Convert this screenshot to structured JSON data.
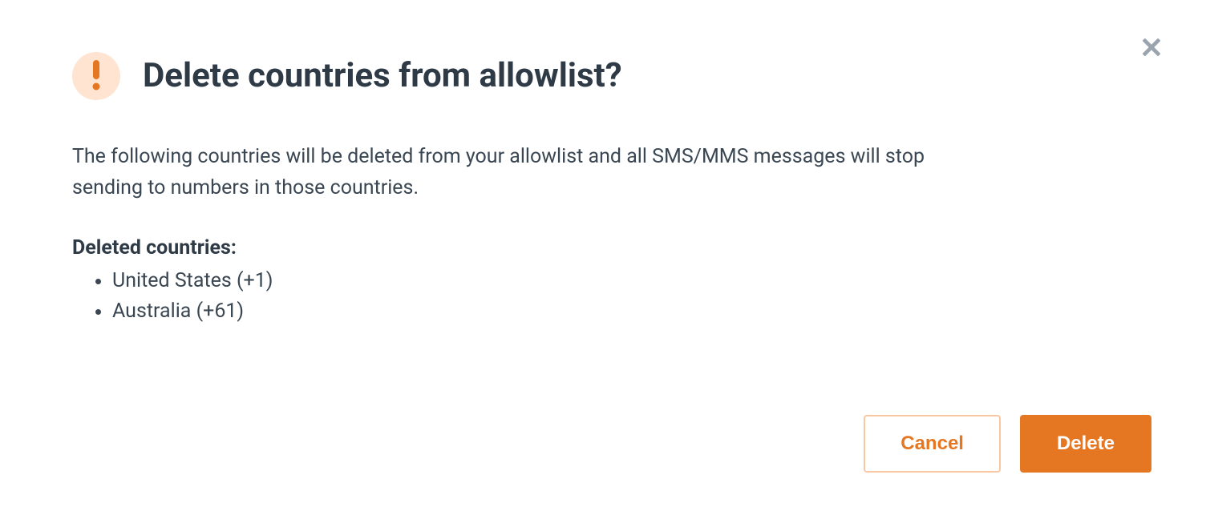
{
  "modal": {
    "title": "Delete countries from allowlist?",
    "description": "The following countries will be deleted from your allowlist and all SMS/MMS messages will stop sending to numbers in those countries.",
    "deleted_label": "Deleted countries:",
    "countries": [
      "United States (+1)",
      "Australia (+61)"
    ],
    "cancel_label": "Cancel",
    "delete_label": "Delete"
  },
  "icons": {
    "warning": "exclamation-icon",
    "close": "close-icon"
  },
  "colors": {
    "accent": "#e67722",
    "accent_light": "#ffe4d1",
    "text_primary": "#2e3a46",
    "text_body": "#3a4753",
    "close_icon": "#9aa4ae"
  }
}
